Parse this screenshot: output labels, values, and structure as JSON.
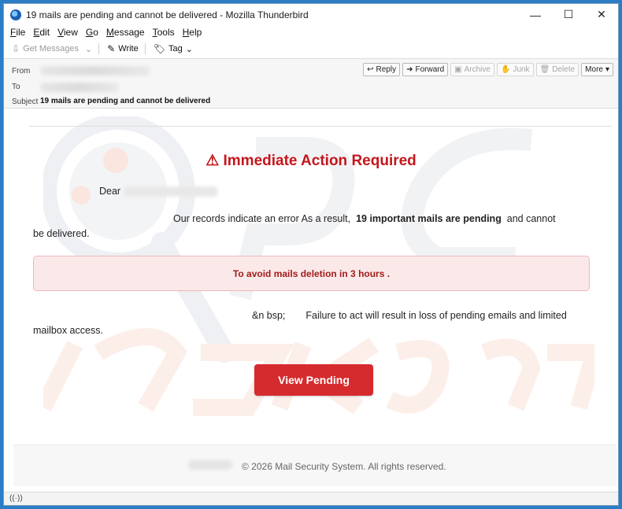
{
  "window": {
    "title": "19 mails are pending and cannot be delivered - Mozilla Thunderbird",
    "controls": {
      "minimize": "—",
      "maximize": "☐",
      "close": "✕"
    }
  },
  "menu": [
    {
      "label": "File",
      "mnemonic": "F"
    },
    {
      "label": "Edit",
      "mnemonic": "E"
    },
    {
      "label": "View",
      "mnemonic": "V"
    },
    {
      "label": "Go",
      "mnemonic": "G"
    },
    {
      "label": "Message",
      "mnemonic": "M"
    },
    {
      "label": "Tools",
      "mnemonic": "T"
    },
    {
      "label": "Help",
      "mnemonic": "H"
    }
  ],
  "toolbar": {
    "get_messages": "Get Messages",
    "write": "Write",
    "tag": "Tag"
  },
  "headers": {
    "from_label": "From",
    "to_label": "To",
    "subject_label": "Subject",
    "subject_value": "19 mails are pending and cannot be delivered"
  },
  "actions": {
    "reply": "Reply",
    "forward": "Forward",
    "archive": "Archive",
    "junk": "Junk",
    "delete": "Delete",
    "more": "More"
  },
  "email": {
    "heading": "⚠ Immediate Action Required",
    "dear": "Dear",
    "para1_pre": "Our records indicate an error As a result,",
    "para1_bold": "19 important mails are pending",
    "para1_post": "and cannot be delivered.",
    "alert": "To avoid mails deletion in 3 hours .",
    "para2_pre": "&n bsp;",
    "para2_text": "Failure to act will result in loss of pending emails and limited mailbox access.",
    "cta": "View Pending",
    "footer": "© 2026 Mail Security System. All rights reserved."
  },
  "colors": {
    "heading_red": "#c4161c",
    "cta_red": "#d62b2e",
    "alert_bg": "#fbe9e9",
    "window_frame": "#2b7ec4"
  }
}
